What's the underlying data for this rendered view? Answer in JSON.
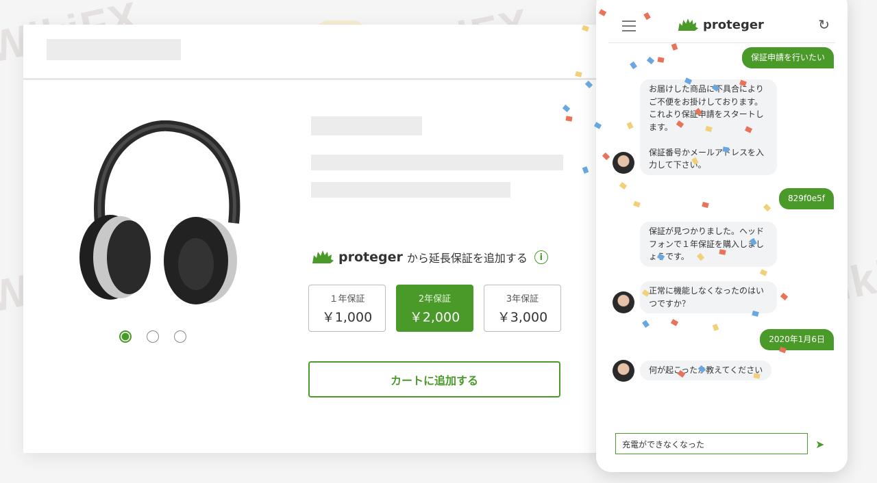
{
  "watermark": {
    "text": "WikiFX"
  },
  "colors": {
    "brand_green": "#4a9a2a",
    "text": "#333333",
    "placeholder_gray": "#ececec"
  },
  "product": {
    "image_icon": "headphones-icon",
    "carousel_dots": [
      {
        "active": true
      },
      {
        "active": false
      },
      {
        "active": false
      }
    ]
  },
  "warranty": {
    "brand": "proteger",
    "label": "から延長保証を追加する",
    "info_icon": "i",
    "plans": [
      {
        "label": "１年保証",
        "price": "￥1,000",
        "selected": false
      },
      {
        "label": "2年保証",
        "price": "￥2,000",
        "selected": true
      },
      {
        "label": "3年保証",
        "price": "￥3,000",
        "selected": false
      }
    ],
    "cart_button": "カートに追加する"
  },
  "chat": {
    "brand": "proteger",
    "menu_icon": "hamburger-menu-icon",
    "refresh_icon": "refresh-icon",
    "messages": [
      {
        "from": "user",
        "text": "保証申請を行いたい"
      },
      {
        "from": "bot",
        "text": "お届けした商品に不具合により\nご不便をお掛けしております。\nこれより保証申請をスタートし\nます。\n\n保証番号かメールアドレスを入\n力して下さい。"
      },
      {
        "from": "user",
        "text": "829f0e5f"
      },
      {
        "from": "bot",
        "text": "保証が見つかりました。ヘッド\nフォンで１年保証を購入しまし\nょうです。"
      },
      {
        "from": "bot",
        "text": "正常に機能しなくなったのはい\nつですか？"
      },
      {
        "from": "user",
        "text": "2020年1月6日"
      },
      {
        "from": "bot",
        "text": "何が起こったか教えてください"
      }
    ],
    "input_value": "充電ができなくなった",
    "send_icon": "send-icon"
  }
}
